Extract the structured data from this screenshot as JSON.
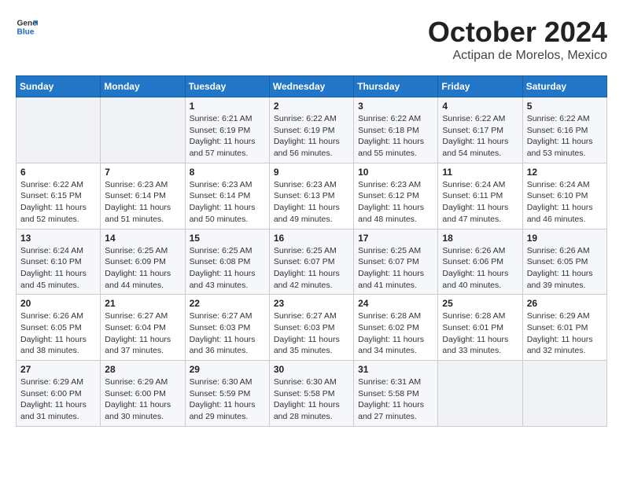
{
  "header": {
    "logo_general": "General",
    "logo_blue": "Blue",
    "month_title": "October 2024",
    "location": "Actipan de Morelos, Mexico"
  },
  "weekdays": [
    "Sunday",
    "Monday",
    "Tuesday",
    "Wednesday",
    "Thursday",
    "Friday",
    "Saturday"
  ],
  "weeks": [
    [
      {
        "day": "",
        "info": ""
      },
      {
        "day": "",
        "info": ""
      },
      {
        "day": "1",
        "info": "Sunrise: 6:21 AM\nSunset: 6:19 PM\nDaylight: 11 hours\nand 57 minutes."
      },
      {
        "day": "2",
        "info": "Sunrise: 6:22 AM\nSunset: 6:19 PM\nDaylight: 11 hours\nand 56 minutes."
      },
      {
        "day": "3",
        "info": "Sunrise: 6:22 AM\nSunset: 6:18 PM\nDaylight: 11 hours\nand 55 minutes."
      },
      {
        "day": "4",
        "info": "Sunrise: 6:22 AM\nSunset: 6:17 PM\nDaylight: 11 hours\nand 54 minutes."
      },
      {
        "day": "5",
        "info": "Sunrise: 6:22 AM\nSunset: 6:16 PM\nDaylight: 11 hours\nand 53 minutes."
      }
    ],
    [
      {
        "day": "6",
        "info": "Sunrise: 6:22 AM\nSunset: 6:15 PM\nDaylight: 11 hours\nand 52 minutes."
      },
      {
        "day": "7",
        "info": "Sunrise: 6:23 AM\nSunset: 6:14 PM\nDaylight: 11 hours\nand 51 minutes."
      },
      {
        "day": "8",
        "info": "Sunrise: 6:23 AM\nSunset: 6:14 PM\nDaylight: 11 hours\nand 50 minutes."
      },
      {
        "day": "9",
        "info": "Sunrise: 6:23 AM\nSunset: 6:13 PM\nDaylight: 11 hours\nand 49 minutes."
      },
      {
        "day": "10",
        "info": "Sunrise: 6:23 AM\nSunset: 6:12 PM\nDaylight: 11 hours\nand 48 minutes."
      },
      {
        "day": "11",
        "info": "Sunrise: 6:24 AM\nSunset: 6:11 PM\nDaylight: 11 hours\nand 47 minutes."
      },
      {
        "day": "12",
        "info": "Sunrise: 6:24 AM\nSunset: 6:10 PM\nDaylight: 11 hours\nand 46 minutes."
      }
    ],
    [
      {
        "day": "13",
        "info": "Sunrise: 6:24 AM\nSunset: 6:10 PM\nDaylight: 11 hours\nand 45 minutes."
      },
      {
        "day": "14",
        "info": "Sunrise: 6:25 AM\nSunset: 6:09 PM\nDaylight: 11 hours\nand 44 minutes."
      },
      {
        "day": "15",
        "info": "Sunrise: 6:25 AM\nSunset: 6:08 PM\nDaylight: 11 hours\nand 43 minutes."
      },
      {
        "day": "16",
        "info": "Sunrise: 6:25 AM\nSunset: 6:07 PM\nDaylight: 11 hours\nand 42 minutes."
      },
      {
        "day": "17",
        "info": "Sunrise: 6:25 AM\nSunset: 6:07 PM\nDaylight: 11 hours\nand 41 minutes."
      },
      {
        "day": "18",
        "info": "Sunrise: 6:26 AM\nSunset: 6:06 PM\nDaylight: 11 hours\nand 40 minutes."
      },
      {
        "day": "19",
        "info": "Sunrise: 6:26 AM\nSunset: 6:05 PM\nDaylight: 11 hours\nand 39 minutes."
      }
    ],
    [
      {
        "day": "20",
        "info": "Sunrise: 6:26 AM\nSunset: 6:05 PM\nDaylight: 11 hours\nand 38 minutes."
      },
      {
        "day": "21",
        "info": "Sunrise: 6:27 AM\nSunset: 6:04 PM\nDaylight: 11 hours\nand 37 minutes."
      },
      {
        "day": "22",
        "info": "Sunrise: 6:27 AM\nSunset: 6:03 PM\nDaylight: 11 hours\nand 36 minutes."
      },
      {
        "day": "23",
        "info": "Sunrise: 6:27 AM\nSunset: 6:03 PM\nDaylight: 11 hours\nand 35 minutes."
      },
      {
        "day": "24",
        "info": "Sunrise: 6:28 AM\nSunset: 6:02 PM\nDaylight: 11 hours\nand 34 minutes."
      },
      {
        "day": "25",
        "info": "Sunrise: 6:28 AM\nSunset: 6:01 PM\nDaylight: 11 hours\nand 33 minutes."
      },
      {
        "day": "26",
        "info": "Sunrise: 6:29 AM\nSunset: 6:01 PM\nDaylight: 11 hours\nand 32 minutes."
      }
    ],
    [
      {
        "day": "27",
        "info": "Sunrise: 6:29 AM\nSunset: 6:00 PM\nDaylight: 11 hours\nand 31 minutes."
      },
      {
        "day": "28",
        "info": "Sunrise: 6:29 AM\nSunset: 6:00 PM\nDaylight: 11 hours\nand 30 minutes."
      },
      {
        "day": "29",
        "info": "Sunrise: 6:30 AM\nSunset: 5:59 PM\nDaylight: 11 hours\nand 29 minutes."
      },
      {
        "day": "30",
        "info": "Sunrise: 6:30 AM\nSunset: 5:58 PM\nDaylight: 11 hours\nand 28 minutes."
      },
      {
        "day": "31",
        "info": "Sunrise: 6:31 AM\nSunset: 5:58 PM\nDaylight: 11 hours\nand 27 minutes."
      },
      {
        "day": "",
        "info": ""
      },
      {
        "day": "",
        "info": ""
      }
    ]
  ]
}
